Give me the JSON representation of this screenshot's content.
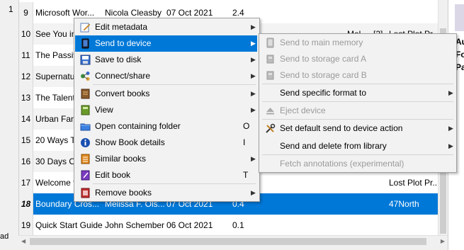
{
  "left_panel": {
    "top_label": "1",
    "bottom_label": "ad"
  },
  "rows": [
    {
      "num": "9",
      "title": "Microsoft Wor...",
      "author": "Nicola Cleasby",
      "date": "07 Oct 2021",
      "size": "2.4",
      "tags": "",
      "series": "",
      "publisher": ""
    },
    {
      "num": "10",
      "title": "See You in",
      "author": "",
      "date": "",
      "size": "",
      "tags": "Mel",
      "series": "[2]",
      "publisher": "Lost Plot Pr..."
    },
    {
      "num": "11",
      "title": "The Passiv",
      "author": "",
      "date": "",
      "size": "",
      "tags": "",
      "series": "",
      "publisher": ""
    },
    {
      "num": "12",
      "title": "Supernatu",
      "author": "",
      "date": "",
      "size": "",
      "tags": "",
      "series": "",
      "publisher": ""
    },
    {
      "num": "13",
      "title": "The Talente",
      "author": "",
      "date": "",
      "size": "",
      "tags": "",
      "series": "",
      "publisher": ""
    },
    {
      "num": "14",
      "title": "Urban Fant",
      "author": "",
      "date": "",
      "size": "",
      "tags": "",
      "series": "",
      "publisher": ""
    },
    {
      "num": "15",
      "title": "20 Ways To",
      "author": "",
      "date": "",
      "size": "",
      "tags": "",
      "series": "",
      "publisher": ""
    },
    {
      "num": "16",
      "title": "30 Days Of",
      "author": "",
      "date": "",
      "size": "",
      "tags": "",
      "series": "",
      "publisher": ""
    },
    {
      "num": "17",
      "title": "Welcome t",
      "author": "",
      "date": "",
      "size": "",
      "tags": "",
      "series": "",
      "publisher": "Lost Plot Pr..."
    },
    {
      "num": "18",
      "title": "Boundary Cros...",
      "author": "Melissa F. Ols...",
      "date": "07 Oct 2021",
      "size": "0.4",
      "tags": "",
      "series": "",
      "publisher": "47North"
    },
    {
      "num": "19",
      "title": "Quick Start Guide",
      "author": "John Schember",
      "date": "06 Oct 2021",
      "size": "0.1",
      "tags": "",
      "series": "",
      "publisher": ""
    }
  ],
  "context_menu": {
    "items": [
      {
        "label": "Edit metadata",
        "icon": "edit-metadata-icon",
        "shortcut": "",
        "submenu": true
      },
      {
        "label": "Send to device",
        "icon": "send-to-device-icon",
        "shortcut": "",
        "submenu": true
      },
      {
        "label": "Save to disk",
        "icon": "save-to-disk-icon",
        "shortcut": "",
        "submenu": true
      },
      {
        "label": "Connect/share",
        "icon": "connect-share-icon",
        "shortcut": "",
        "submenu": true
      },
      {
        "label": "Convert books",
        "icon": "convert-books-icon",
        "shortcut": "",
        "submenu": true
      },
      {
        "label": "View",
        "icon": "view-icon",
        "shortcut": "",
        "submenu": true
      },
      {
        "label": "Open containing folder",
        "icon": "folder-icon",
        "shortcut": "O",
        "submenu": false
      },
      {
        "label": "Show Book details",
        "icon": "info-icon",
        "shortcut": "I",
        "submenu": false
      },
      {
        "label": "Similar books",
        "icon": "similar-books-icon",
        "shortcut": "",
        "submenu": true
      },
      {
        "label": "Edit book",
        "icon": "edit-book-icon",
        "shortcut": "T",
        "submenu": false
      },
      {
        "label": "Remove books",
        "icon": "remove-books-icon",
        "shortcut": "",
        "submenu": true
      }
    ]
  },
  "submenu": {
    "items": [
      {
        "label": "Send to main memory",
        "icon": "device-memory-icon",
        "disabled": true,
        "submenu": false
      },
      {
        "label": "Send to storage card A",
        "icon": "device-card-icon",
        "disabled": true,
        "submenu": false
      },
      {
        "label": "Send to storage card B",
        "icon": "device-card-icon",
        "disabled": true,
        "submenu": false
      },
      {
        "label": "Send specific format to",
        "icon": "",
        "disabled": false,
        "submenu": true
      },
      {
        "label": "Eject device",
        "icon": "eject-icon",
        "disabled": true,
        "submenu": false
      },
      {
        "label": "Set default send to device action",
        "icon": "tools-icon",
        "disabled": false,
        "submenu": true
      },
      {
        "label": "Send and delete from library",
        "icon": "",
        "disabled": false,
        "submenu": true
      },
      {
        "label": "Fetch annotations (experimental)",
        "icon": "",
        "disabled": true,
        "submenu": false
      }
    ]
  },
  "right_panel": {
    "lines": [
      "Au",
      "Fo",
      "Pa"
    ]
  },
  "colors": {
    "selection": "#0078d7",
    "menu_bg": "#f2f2f2"
  }
}
